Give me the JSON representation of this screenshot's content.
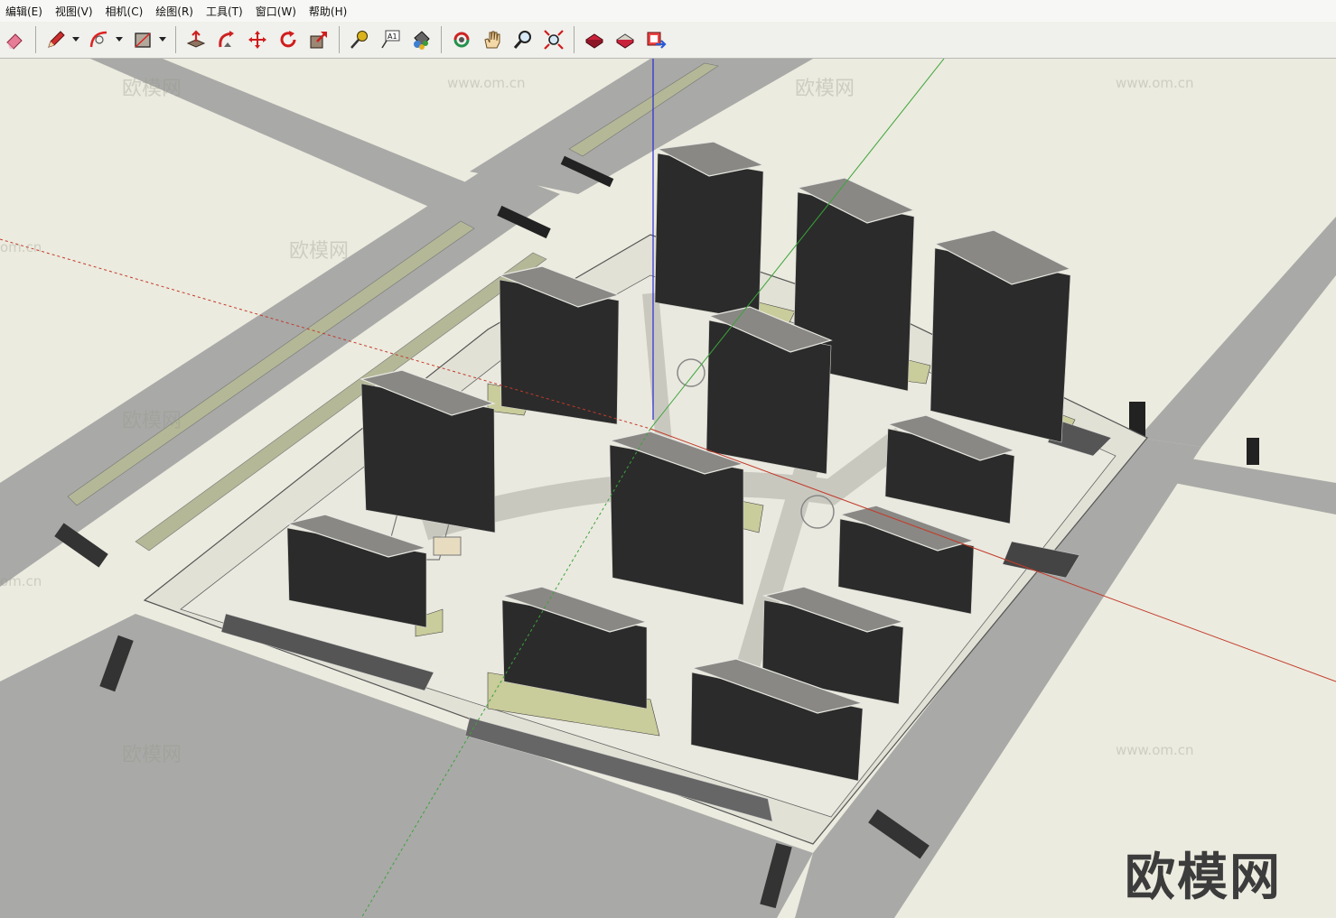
{
  "menu": {
    "items": [
      "编辑(E)",
      "视图(V)",
      "相机(C)",
      "绘图(R)",
      "工具(T)",
      "窗口(W)",
      "帮助(H)"
    ]
  },
  "toolbar": {
    "buttons": [
      {
        "icon": "eraser-icon"
      },
      {
        "icon": "pencil-icon"
      },
      {
        "icon": "arc-icon"
      },
      {
        "icon": "rectangle-icon"
      },
      {
        "icon": "push-pull-icon"
      },
      {
        "icon": "follow-me-icon"
      },
      {
        "icon": "move-icon"
      },
      {
        "icon": "rotate-icon"
      },
      {
        "icon": "scale-icon"
      },
      {
        "icon": "tape-measure-icon"
      },
      {
        "icon": "text-icon",
        "label": "A1"
      },
      {
        "icon": "paint-bucket-icon"
      },
      {
        "icon": "orbit-icon"
      },
      {
        "icon": "pan-icon"
      },
      {
        "icon": "zoom-icon"
      },
      {
        "icon": "zoom-extents-icon"
      },
      {
        "icon": "warehouse-icon"
      },
      {
        "icon": "share-model-icon"
      },
      {
        "icon": "components-icon"
      }
    ]
  },
  "viewport": {
    "watermark_brand": "欧模网",
    "watermark_url": "www.om.cn",
    "watermark_url_partial": "om.cn"
  },
  "colors": {
    "ground": "#ecebdf",
    "road": "#a7a7a5",
    "median": "#b4b897",
    "building": "#2b2b2b",
    "axis_red": "#c33a2a",
    "axis_green": "#3aa43a",
    "axis_blue": "#2a2ad6"
  }
}
